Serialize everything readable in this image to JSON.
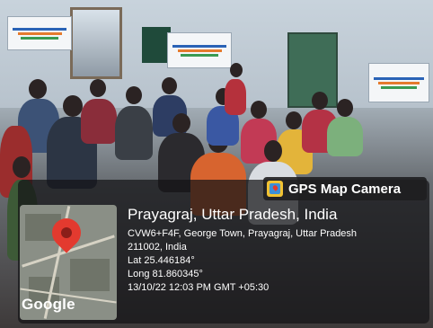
{
  "overlay": {
    "app_tag": "GPS Map Camera",
    "map_brand": "Google",
    "city": "Prayagraj, Uttar Pradesh, India",
    "address_line1": "CVW6+F4F, George Town, Prayagraj, Uttar Pradesh",
    "address_line2": "211002, India",
    "latitude": "Lat 25.446184°",
    "longitude": "Long 81.860345°",
    "datetime": "13/10/22 12:03 PM GMT +05:30"
  },
  "colors": {
    "pin": "#e33a2f",
    "panel": "#141416",
    "tag_icon": "#f1c233"
  },
  "icons": [
    "map-pin-icon",
    "gps-camera-icon"
  ]
}
